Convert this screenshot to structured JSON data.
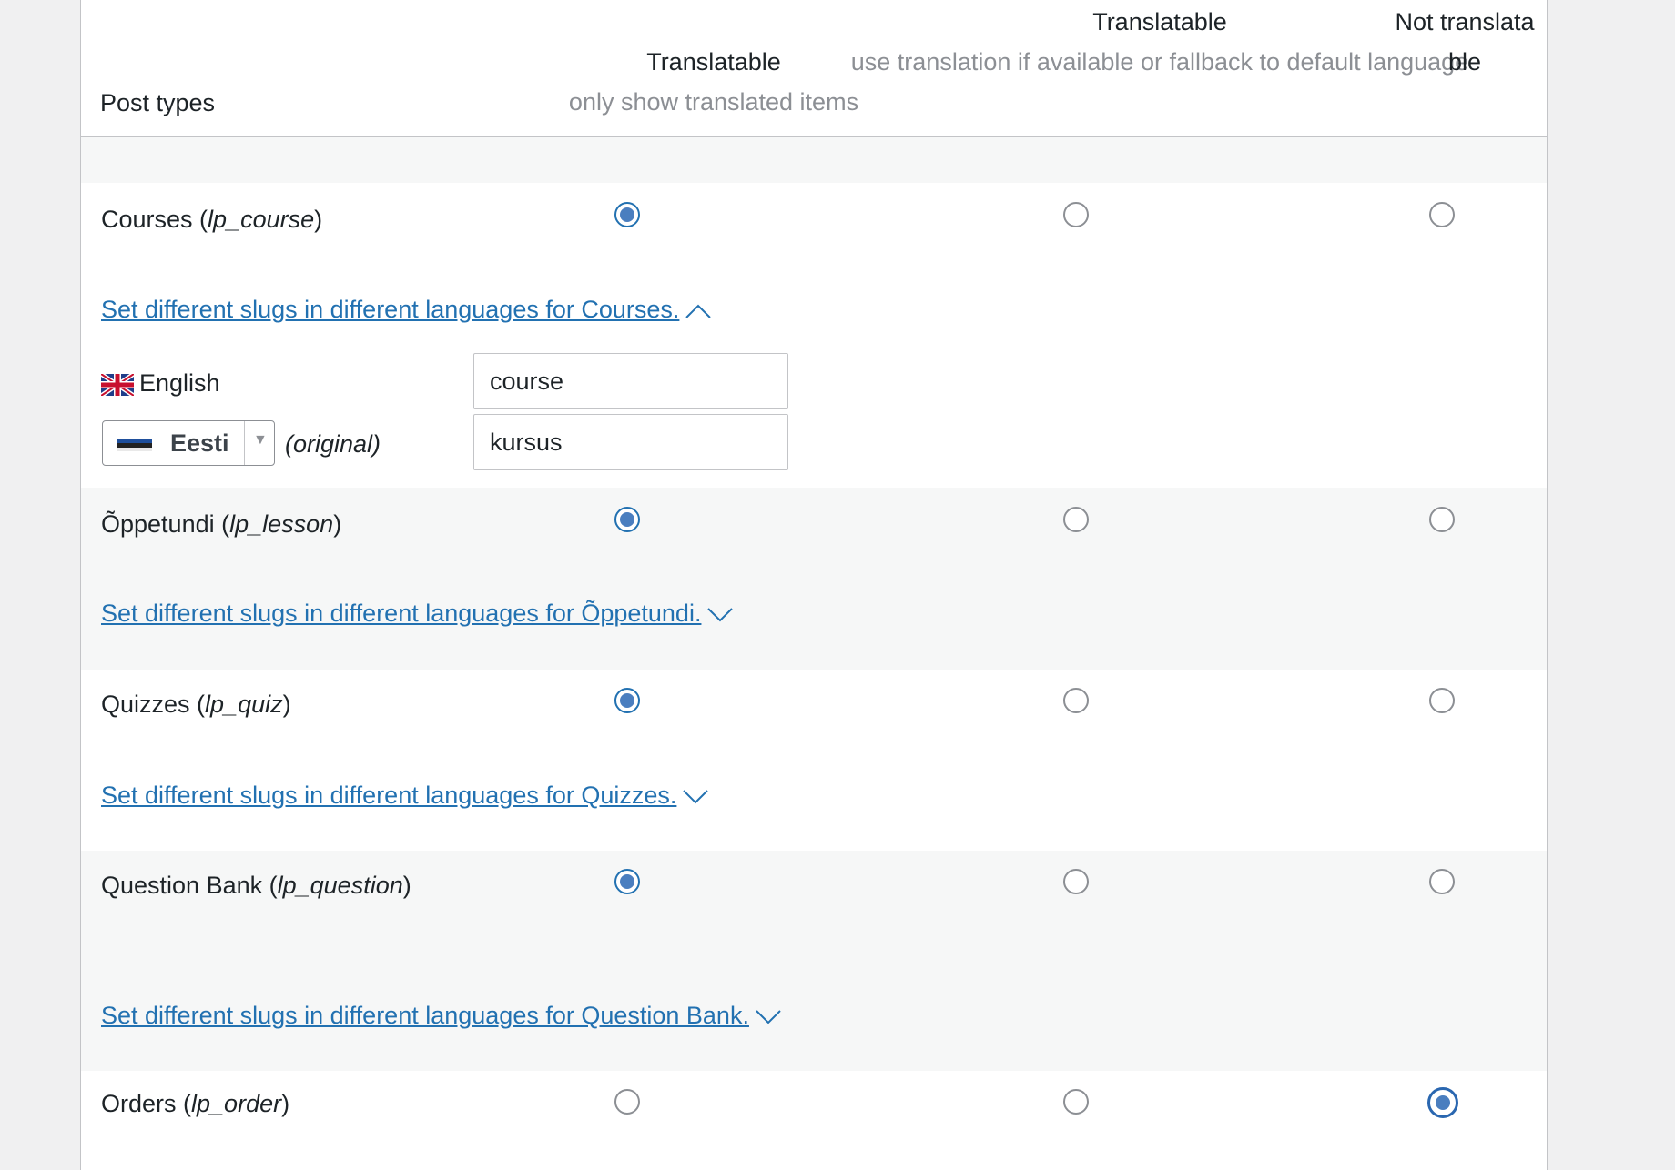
{
  "header": {
    "post_types": "Post types",
    "col1_title": "Translatable",
    "col1_sub": "only show translated items",
    "col2_title": "Translatable",
    "col2_sub": "use translation if available or fallback to default language",
    "col3_title": "Not translatable"
  },
  "rows": [
    {
      "name": "Courses",
      "slug": "lp_course",
      "selected": "translatable",
      "link": "Set different slugs in different languages for Courses.",
      "expanded": true,
      "languages": [
        {
          "label": "English",
          "value": "course"
        },
        {
          "label": "Eesti",
          "value": "kursus",
          "note": "(original)"
        }
      ]
    },
    {
      "name": "Õppetundi",
      "slug": "lp_lesson",
      "selected": "translatable",
      "link": "Set different slugs in different languages for Õppetundi.",
      "expanded": false
    },
    {
      "name": "Quizzes",
      "slug": "lp_quiz",
      "selected": "translatable",
      "link": "Set different slugs in different languages for Quizzes.",
      "expanded": false
    },
    {
      "name": "Question Bank",
      "slug": "lp_question",
      "selected": "translatable",
      "link": "Set different slugs in different languages for Question Bank.",
      "expanded": false
    },
    {
      "name": "Orders",
      "slug": "lp_order",
      "selected": "not_translatable"
    }
  ],
  "colors": {
    "link": "#2271b1",
    "radio_checked": "#4a7ebf",
    "muted_text": "#8c8f94",
    "alt_row": "#f6f7f7"
  },
  "icons": {
    "expanded_chevron": "chevron-up-icon",
    "collapsed_chevron": "chevron-down-icon",
    "english_flag": "uk-flag-icon",
    "estonian_flag": "estonia-flag-icon",
    "dropdown": "caret-down-icon"
  }
}
